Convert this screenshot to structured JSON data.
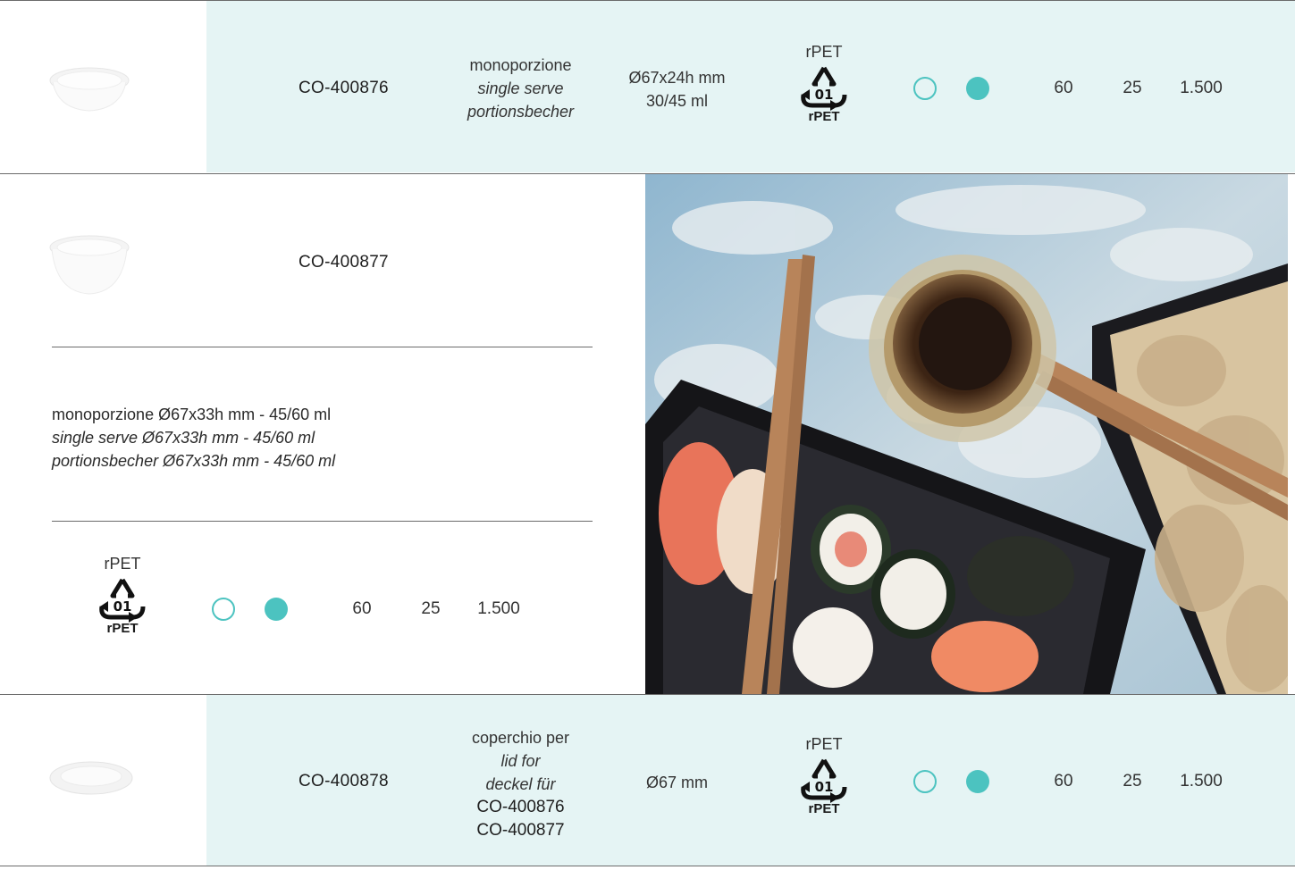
{
  "rows": [
    {
      "code": "CO-400876",
      "desc": [
        "monoporzione",
        "single serve",
        "portionsbecher"
      ],
      "size": [
        "Ø67x24h mm",
        "30/45 ml"
      ],
      "material_top": "rPET",
      "material_num": "01",
      "material_bottom": "rPET",
      "qty1": "60",
      "qty2": "25",
      "qty3": "1.500"
    },
    {
      "code": "CO-400877",
      "desc": [
        "monoporzione Ø67x33h mm - 45/60 ml",
        "single serve Ø67x33h mm - 45/60 ml",
        "portionsbecher Ø67x33h mm - 45/60 ml"
      ],
      "material_top": "rPET",
      "material_num": "01",
      "material_bottom": "rPET",
      "qty1": "60",
      "qty2": "25",
      "qty3": "1.500"
    },
    {
      "code": "CO-400878",
      "desc": [
        "coperchio per",
        "lid for",
        "deckel für",
        "CO-400876",
        "CO-400877"
      ],
      "size": [
        "Ø67 mm"
      ],
      "material_top": "rPET",
      "material_num": "01",
      "material_bottom": "rPET",
      "qty1": "60",
      "qty2": "25",
      "qty3": "1.500"
    }
  ],
  "colors": {
    "tint": "#e5f4f4",
    "accent": "#4cc3c0",
    "rule": "#6b6b6b"
  },
  "icons": {
    "recycle": "recycle-pet-icon",
    "outline_dot": "outline-circle-icon",
    "filled_dot": "filled-circle-icon"
  }
}
